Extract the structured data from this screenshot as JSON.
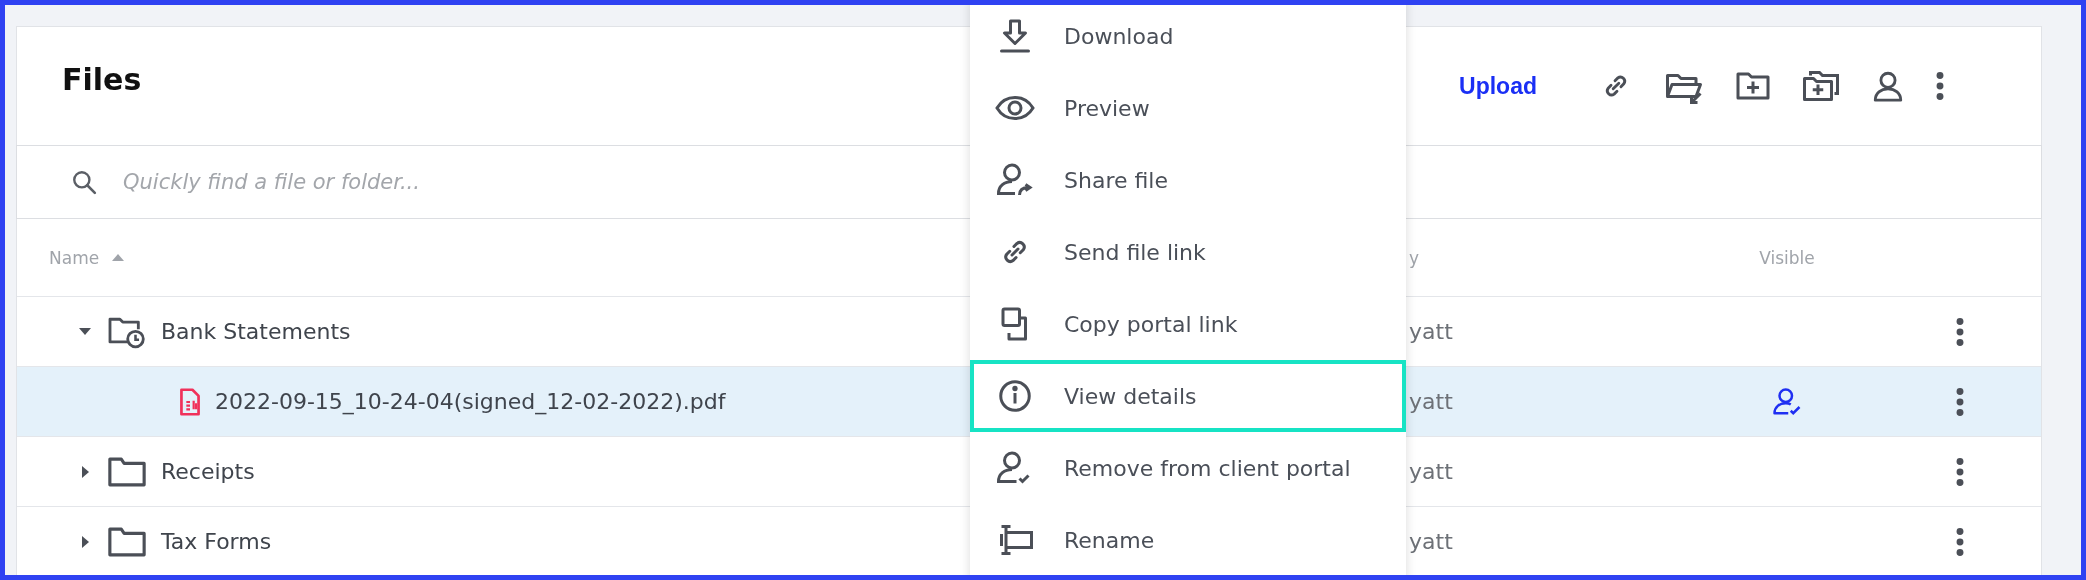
{
  "header": {
    "title": "Files",
    "upload": "Upload"
  },
  "search": {
    "placeholder": "Quickly find a file or folder..."
  },
  "table": {
    "columns": [
      "Name",
      "y",
      "Visible"
    ],
    "sort_ascending": true,
    "rows": [
      {
        "kind": "folder_clock",
        "name": "Bank Statements",
        "column_2": "yatt",
        "expanded": true,
        "selected": false,
        "client_visible": false,
        "children": [
          {
            "kind": "file",
            "name": "2022-09-15_10-24-04(signed_12-02-2022).pdf",
            "column_2": "yatt",
            "selected": true,
            "client_visible": true
          }
        ]
      },
      {
        "kind": "folder",
        "name": "Receipts",
        "column_2": "yatt",
        "expanded": false,
        "selected": false,
        "client_visible": false
      },
      {
        "kind": "folder",
        "name": "Tax Forms",
        "column_2": "yatt",
        "expanded": false,
        "selected": false,
        "client_visible": false
      }
    ]
  },
  "menu": [
    {
      "label": "Download",
      "selected": false
    },
    {
      "label": "Preview",
      "selected": false
    },
    {
      "label": "Share file",
      "selected": false
    },
    {
      "label": "Send file link",
      "selected": false
    },
    {
      "label": "Copy portal link",
      "selected": false
    },
    {
      "label": "View details",
      "selected": true
    },
    {
      "label": "Remove from client portal",
      "selected": false
    },
    {
      "label": "Rename",
      "selected": false
    }
  ]
}
